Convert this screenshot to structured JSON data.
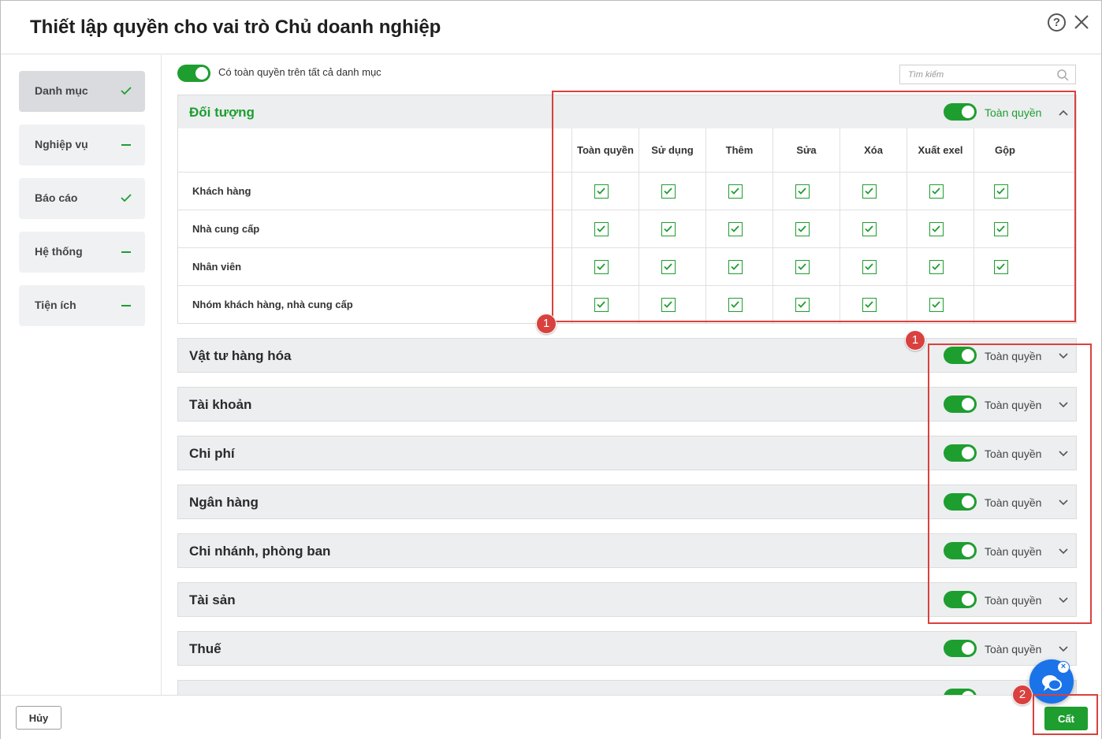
{
  "dialog": {
    "title": "Thiết lập quyền cho vai trò Chủ doanh nghiệp"
  },
  "sidebar": {
    "items": [
      {
        "label": "Danh mục",
        "mark": "check",
        "active": true
      },
      {
        "label": "Nghiệp vụ",
        "mark": "dash"
      },
      {
        "label": "Báo cáo",
        "mark": "check"
      },
      {
        "label": "Hệ thống",
        "mark": "dash"
      },
      {
        "label": "Tiện ích",
        "mark": "dash"
      }
    ]
  },
  "main": {
    "all_toggle_label": "Có toàn quyền trên tất cả danh mục",
    "search_placeholder": "Tìm kiếm",
    "expanded_group": {
      "title": "Đối tượng",
      "toggle_label": "Toàn quyền",
      "columns": [
        "Toàn quyền",
        "Sử dụng",
        "Thêm",
        "Sửa",
        "Xóa",
        "Xuất exel",
        "Gộp"
      ],
      "rows": [
        {
          "label": "Khách hàng",
          "checks": [
            true,
            true,
            true,
            true,
            true,
            true,
            true
          ]
        },
        {
          "label": "Nhà cung cấp",
          "checks": [
            true,
            true,
            true,
            true,
            true,
            true,
            true
          ]
        },
        {
          "label": "Nhân viên",
          "checks": [
            true,
            true,
            true,
            true,
            true,
            true,
            true
          ]
        },
        {
          "label": "Nhóm khách hàng, nhà cung cấp",
          "checks": [
            true,
            true,
            true,
            true,
            true,
            true,
            null
          ]
        }
      ]
    },
    "groups": [
      {
        "title": "Vật tư hàng hóa",
        "toggle_label": "Toàn quyền"
      },
      {
        "title": "Tài khoản",
        "toggle_label": "Toàn quyền"
      },
      {
        "title": "Chi phí",
        "toggle_label": "Toàn quyền"
      },
      {
        "title": "Ngân hàng",
        "toggle_label": "Toàn quyền"
      },
      {
        "title": "Chi nhánh, phòng ban",
        "toggle_label": "Toàn quyền"
      },
      {
        "title": "Tài sản",
        "toggle_label": "Toàn quyền"
      },
      {
        "title": "Thuế",
        "toggle_label": "Toàn quyền"
      }
    ]
  },
  "annotations": {
    "badge1": "1",
    "badge2": "2"
  },
  "footer": {
    "cancel_label": "Hủy",
    "save_label": "Cất"
  },
  "colors": {
    "accent": "#1e9e2f",
    "annotation": "#d9413e",
    "chat": "#1a73e8"
  }
}
